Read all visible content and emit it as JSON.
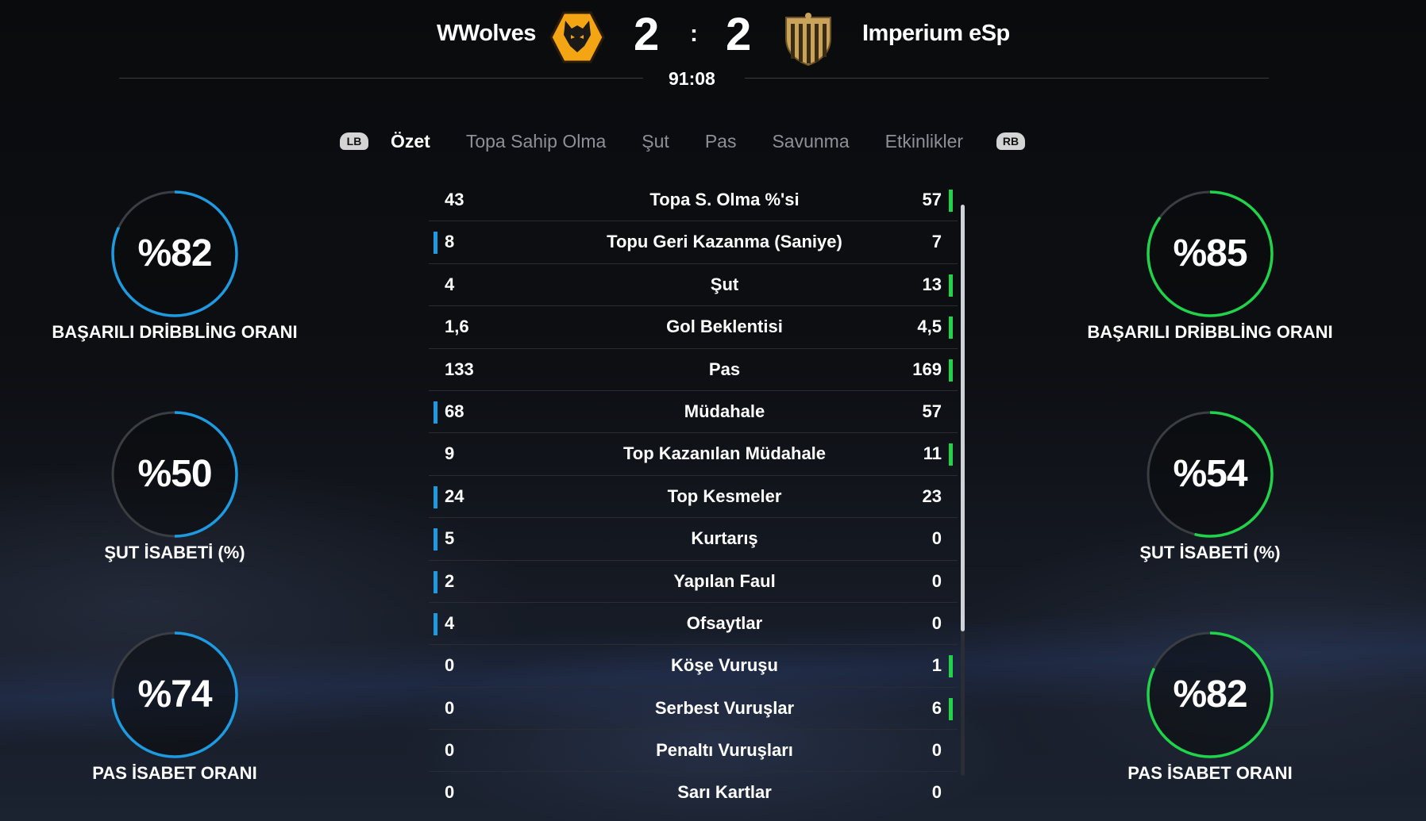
{
  "header": {
    "home_team": "WWolves",
    "away_team": "Imperium eSp",
    "home_score": "2",
    "away_score": "2",
    "separator": ":",
    "clock": "91:08",
    "home_crest_icon": "wolf-crest-icon",
    "away_crest_icon": "striped-shield-crest-icon"
  },
  "tabs": {
    "lb": "LB",
    "rb": "RB",
    "items": [
      "Özet",
      "Topa Sahip Olma",
      "Şut",
      "Pas",
      "Savunma",
      "Etkinlikler"
    ],
    "active": "Özet"
  },
  "colors": {
    "home": "#1e9be0",
    "away": "#21d34b",
    "ring_bg": "#3a3d42"
  },
  "stats": [
    {
      "label": "Topa S. Olma %'si",
      "home": "43",
      "away": "57",
      "leader": "away"
    },
    {
      "label": "Topu Geri Kazanma (Saniye)",
      "home": "8",
      "away": "7",
      "leader": "home"
    },
    {
      "label": "Şut",
      "home": "4",
      "away": "13",
      "leader": "away"
    },
    {
      "label": "Gol Beklentisi",
      "home": "1,6",
      "away": "4,5",
      "leader": "away"
    },
    {
      "label": "Pas",
      "home": "133",
      "away": "169",
      "leader": "away"
    },
    {
      "label": "Müdahale",
      "home": "68",
      "away": "57",
      "leader": "home"
    },
    {
      "label": "Top Kazanılan Müdahale",
      "home": "9",
      "away": "11",
      "leader": "away"
    },
    {
      "label": "Top Kesmeler",
      "home": "24",
      "away": "23",
      "leader": "home"
    },
    {
      "label": "Kurtarış",
      "home": "5",
      "away": "0",
      "leader": "home"
    },
    {
      "label": "Yapılan Faul",
      "home": "2",
      "away": "0",
      "leader": "home"
    },
    {
      "label": "Ofsaytlar",
      "home": "4",
      "away": "0",
      "leader": "home"
    },
    {
      "label": "Köşe Vuruşu",
      "home": "0",
      "away": "1",
      "leader": "away"
    },
    {
      "label": "Serbest Vuruşlar",
      "home": "0",
      "away": "6",
      "leader": "away"
    },
    {
      "label": "Penaltı Vuruşları",
      "home": "0",
      "away": "0",
      "leader": "none"
    },
    {
      "label": "Sarı Kartlar",
      "home": "0",
      "away": "0",
      "leader": "none"
    }
  ],
  "rings": {
    "home": [
      {
        "value": "%82",
        "fraction": 0.82,
        "label": "BAŞARILI DRİBBLİNG ORANI"
      },
      {
        "value": "%50",
        "fraction": 0.5,
        "label": "ŞUT İSABETİ (%)"
      },
      {
        "value": "%74",
        "fraction": 0.74,
        "label": "PAS İSABET ORANI"
      }
    ],
    "away": [
      {
        "value": "%85",
        "fraction": 0.85,
        "label": "BAŞARILI DRİBBLİNG ORANI"
      },
      {
        "value": "%54",
        "fraction": 0.54,
        "label": "ŞUT İSABETİ (%)"
      },
      {
        "value": "%82",
        "fraction": 0.82,
        "label": "PAS İSABET ORANI"
      }
    ]
  }
}
